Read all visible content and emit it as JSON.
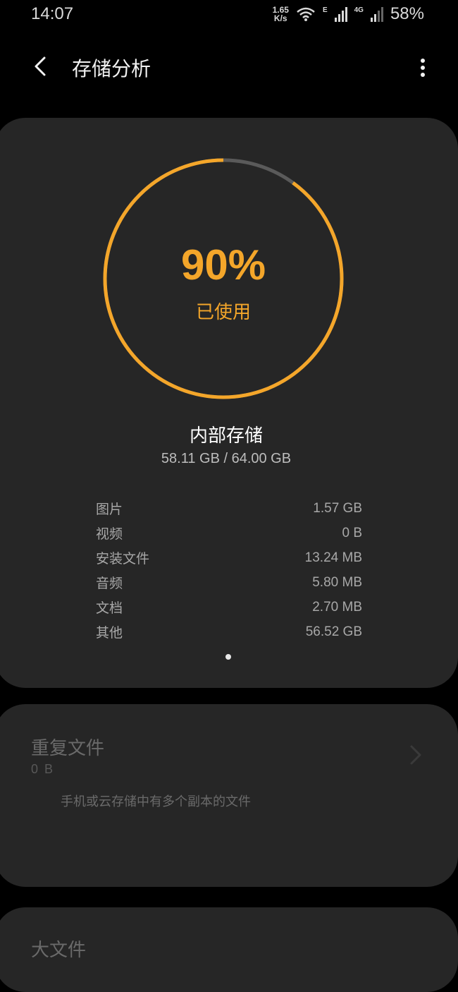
{
  "status_bar": {
    "time": "14:07",
    "net_speed_value": "1.65",
    "net_speed_unit": "K/s",
    "wifi_icon": "wifi-icon",
    "net_type_1": "E",
    "net_type_2": "4G",
    "battery": "58%"
  },
  "app_bar": {
    "title": "存储分析",
    "back_icon": "back-arrow-icon",
    "more_icon": "more-vert-icon"
  },
  "storage": {
    "used_percent": 90,
    "used_percent_label": "90%",
    "used_label": "已使用",
    "name": "内部存储",
    "amount": "58.11 GB / 64.00 GB",
    "colors": {
      "accent": "#f4a62a",
      "track": "#5a5a5a",
      "card": "#262626"
    },
    "breakdown": [
      {
        "label": "图片",
        "value": "1.57 GB"
      },
      {
        "label": "视频",
        "value": "0 B"
      },
      {
        "label": "安装文件",
        "value": "13.24 MB"
      },
      {
        "label": "音频",
        "value": "5.80 MB"
      },
      {
        "label": "文档",
        "value": "2.70 MB"
      },
      {
        "label": "其他",
        "value": "56.52 GB"
      }
    ]
  },
  "duplicates": {
    "title": "重复文件",
    "size": "0 B",
    "description": "手机或云存储中有多个副本的文件"
  },
  "large_files": {
    "title": "大文件"
  }
}
